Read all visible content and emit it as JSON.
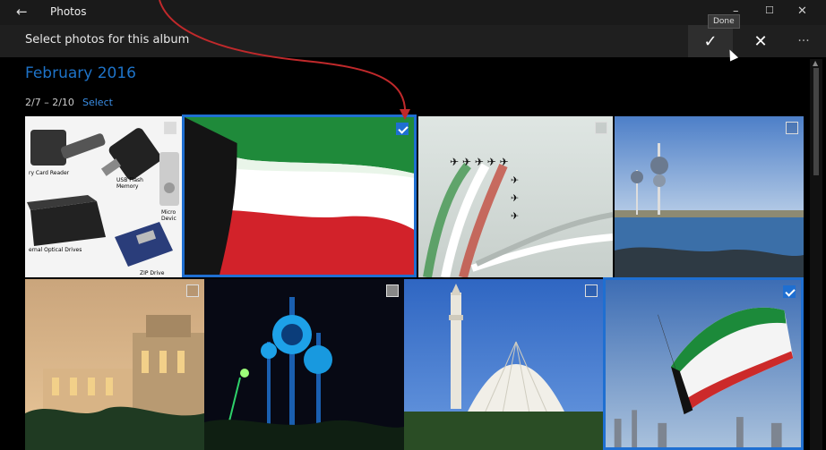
{
  "app": {
    "title": "Photos"
  },
  "command_bar": {
    "prompt": "Select photos for this album",
    "done_tooltip": "Done"
  },
  "section": {
    "month": "February 2016",
    "date_range": "2/7 – 2/10",
    "select_label": "Select"
  },
  "photos": [
    {
      "labels": [
        "ry Card Reader",
        "USB Flash Memory",
        "Micro Devic",
        "ernal Optical Drives",
        "ZIP Drive"
      ],
      "selected": false
    },
    {
      "selected": true
    },
    {
      "selected": false
    },
    {
      "selected": false
    },
    {
      "selected": false
    },
    {
      "selected": false
    },
    {
      "selected": false
    },
    {
      "selected": true
    }
  ]
}
